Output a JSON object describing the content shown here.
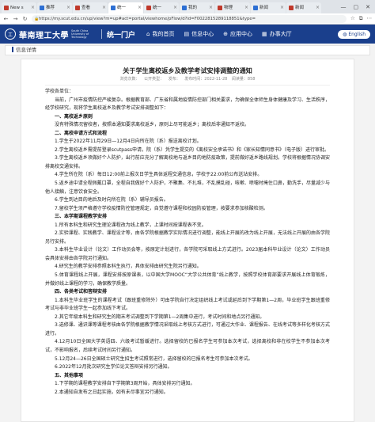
{
  "browser": {
    "tabs": [
      {
        "label": "New s",
        "active": false
      },
      {
        "label": "推荐",
        "active": false
      },
      {
        "label": "查看",
        "active": false
      },
      {
        "label": "统一",
        "active": true
      },
      {
        "label": "统一",
        "active": false
      },
      {
        "label": "我的",
        "active": false
      },
      {
        "label": "物理",
        "active": false
      },
      {
        "label": "新闻",
        "active": false
      },
      {
        "label": "新闻",
        "active": false
      }
    ],
    "url": "https://my.scut.edu.cn/up/view?m=up#act=portal/viewhome/pFlow/d?id=F0022815289118851&type=",
    "window_controls": [
      "—",
      "▢",
      "✕"
    ]
  },
  "site": {
    "logo_glyph": "工",
    "logo_text": "華南理工大學",
    "logo_sub": "South China University of Technology",
    "portal_name": "统一门户",
    "nav": [
      {
        "icon": "home-icon",
        "glyph": "⌂",
        "label": "我的首页"
      },
      {
        "icon": "info-icon",
        "glyph": "▤",
        "label": "信息中心"
      },
      {
        "icon": "apps-icon",
        "glyph": "⊕",
        "label": "应用中心"
      },
      {
        "icon": "hall-icon",
        "glyph": "▦",
        "label": "办事大厅"
      }
    ],
    "lang_button": "English"
  },
  "breadcrumb": "信息详情",
  "article": {
    "title": "关于学生离校返乡及教学考试安排调整的通知",
    "meta": "浏览次数：  公开类型： 发布：  发布时间：2022-11-28  阅读量：858",
    "paragraphs": [
      {
        "type": "p",
        "noindent": true,
        "text": "学校各单位："
      },
      {
        "type": "p",
        "text": "当前，广州市疫情防控严峻复杂。根据教育部、广东省和属地疫情防控部门相关要求，为确保全体师生身体健康及学习、生活秩序，经学校研究，现将学生离校返乡及教学考试安排调整如下："
      },
      {
        "type": "h",
        "text": "一、离校返乡原则"
      },
      {
        "type": "p",
        "text": "没有特殊情况留校者，按照本通知要求离校返乡，原则上尽可能返乡；离校后非通知不返校。"
      },
      {
        "type": "h",
        "text": "二、离校申请方式和流程"
      },
      {
        "type": "p",
        "text": "1.学生于2022年11月29日—12月4日向所在院（系）报送离校计划。"
      },
      {
        "type": "p",
        "text": "2.学生离校返乡需提前登录scutpass申请，院（系）凭学生提交的《离校安全承诺书》和《家长知情同意书》（电子版）进行审批。"
      },
      {
        "type": "p",
        "text": "3.学生离校返乡须做好个人防护，出行前应充分了解离校地与返乡目的地防疫政策，提前做好返乡路线规划。学校将根据情况协调安排离校交通安排。"
      },
      {
        "type": "p",
        "text": "4.学生所在院（系）每日12:00前上报次日学生具体返程交通信息，学校于22:00前公布送站安排。"
      },
      {
        "type": "p",
        "text": "5.返乡途中请全程佩戴口罩，全程自我做好个人防护，不聚集、不扎堆，不乱摸乱碰，咳嗽、喷嚏时掩住口鼻，勤洗手，尽量减少与他人接触，注意饮食安全。"
      },
      {
        "type": "p",
        "text": "6.学生到达目的地后及时向所在院（系）辅导员报告。"
      },
      {
        "type": "p",
        "text": "7.留校学生须严格遵守学校疫情防控管理规定，自觉遵守课程和校园防疫管理，按要求参加核酸检测。"
      },
      {
        "type": "h",
        "text": "三、本学期课程教学安排"
      },
      {
        "type": "p",
        "text": "1.所有本科生和研究生理论课程改为线上教学，上课时间按课程表不变。"
      },
      {
        "type": "p",
        "text": "2.实验课程、实践教学、课程设计等，由各学院根据教学实际情况进行调整，能线上开展的改为线上开展，无法线上开展的由各学院另行安排。"
      },
      {
        "type": "p",
        "text": "3.本科生毕业设计（论文）工作动员会等，按原定计划进行，各学院可采取线上方式进行。2023届本科毕业设计（论文）工作动员会具体安排由各学院另行通知。"
      },
      {
        "type": "p",
        "text": "4.研究生的教学安排参照本科生执行，具体安排由研究生院另行通知。"
      },
      {
        "type": "p",
        "text": "5.体育课程线上开展，课程安排按原课表，以中国大学MOOC“大学公共体育”线上教学，按照学校体育部要求开展线上体育锻炼，并做好线上课程的学习，确保教学质量。"
      },
      {
        "type": "h",
        "text": "四、各类考试和答辩安排"
      },
      {
        "type": "p",
        "text": "1.本科生毕业班学生的课程考试（跟班重修除外）可由学院自行决定组织线上考试或延后到下学期第1—2周，毕业班学生跟班重修考试与非毕业班学生一起参加线下考试。"
      },
      {
        "type": "p",
        "text": "2.其它年级本科生和研究生的期末考试调整到下学期第1—2周集中进行，考试时间和地点另行通知。"
      },
      {
        "type": "p",
        "text": "3.选修课、通识课等课程考核由各学院根据教学情况采取线上考核方式进行，可通过大作业、课程报告、在线考试等多样化考核方式进行。"
      },
      {
        "type": "p",
        "text": "4.12月10日全国大学英语四、六级考试暂缓进行。选择留校的已报名学生可参加本次考试，选择离校和非在校学生不参加本次考试，不影响报名，后续考试时间另行通知。"
      },
      {
        "type": "p",
        "text": "5.12月24—26日全国硕士研究生招生考试照常进行，选择留校的已报名考生可参加本次考试。"
      },
      {
        "type": "p",
        "text": "6.2022年12月批次研究生学位论文答辩安排另行通知。"
      },
      {
        "type": "h",
        "text": "五、其他事项"
      },
      {
        "type": "p",
        "text": "1.下学期的课程教学安排自下学期第3周开始，具体安排另行通知。"
      },
      {
        "type": "p",
        "text": "2.本通知自发布之日起实施，如有未尽事宜另行通知。"
      }
    ]
  }
}
